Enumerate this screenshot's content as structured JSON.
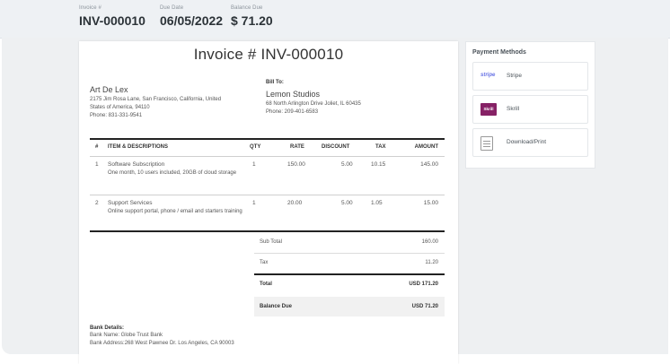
{
  "summary": {
    "invoice_label": "Invoice #",
    "invoice_value": "INV-000010",
    "due_label": "Due Date",
    "due_value": "06/05/2022",
    "balance_label": "Balance Due",
    "balance_value": "$ 71.20"
  },
  "invoice": {
    "title": "Invoice # INV-000010",
    "from": {
      "name": "Art De Lex",
      "address_line1": "2175 Jim Rosa Lane, San Francisco, California, United",
      "address_line2": "States of America, 94110",
      "phone": "Phone: 831-331-9541"
    },
    "bill_to": {
      "label": "Bill To:",
      "name": "Lemon Studios",
      "address": "68 North Arlington Drive Joliet, IL 60435",
      "phone": "Phone: 209-401-6583"
    },
    "columns": {
      "num": "#",
      "item": "ITEM & DESCRIPTIONS",
      "qty": "QTY",
      "rate": "RATE",
      "discount": "DISCOUNT",
      "tax": "TAX",
      "amount": "AMOUNT"
    },
    "items": [
      {
        "num": "1",
        "name": "Software Subscription",
        "description": "One month, 10 users included, 20GB of cloud storage",
        "qty": "1",
        "rate": "150.00",
        "discount": "5.00",
        "tax": "10.15",
        "amount": "145.00"
      },
      {
        "num": "2",
        "name": "Support Services",
        "description": "Online support portal, phone / email and starters training",
        "qty": "1",
        "rate": "20.00",
        "discount": "5.00",
        "tax": "1.05",
        "amount": "15.00"
      }
    ],
    "totals": {
      "subtotal_label": "Sub Total",
      "subtotal_value": "160.00",
      "tax_label": "Tax",
      "tax_value": "11.20",
      "total_label": "Total",
      "total_value": "USD 171.20",
      "balance_label": "Balance Due",
      "balance_value": "USD 71.20"
    },
    "bank": {
      "label": "Bank Details:",
      "name": "Bank Name:   Globe Trust Bank",
      "address": "Bank Address:268 West Pawnee Dr. Los Angeles, CA 90003"
    }
  },
  "payment_methods": {
    "title": "Payment Methods",
    "items": [
      {
        "label": "Stripe",
        "icon": "stripe-icon",
        "icon_text": "stripe"
      },
      {
        "label": "Skrill",
        "icon": "skrill-icon",
        "icon_text": "Skrill"
      },
      {
        "label": "Download/Print",
        "icon": "download-icon"
      }
    ]
  },
  "colors": {
    "page_bg": "#eef0f2",
    "skrill": "#862165",
    "stripe": "#6772e5"
  }
}
